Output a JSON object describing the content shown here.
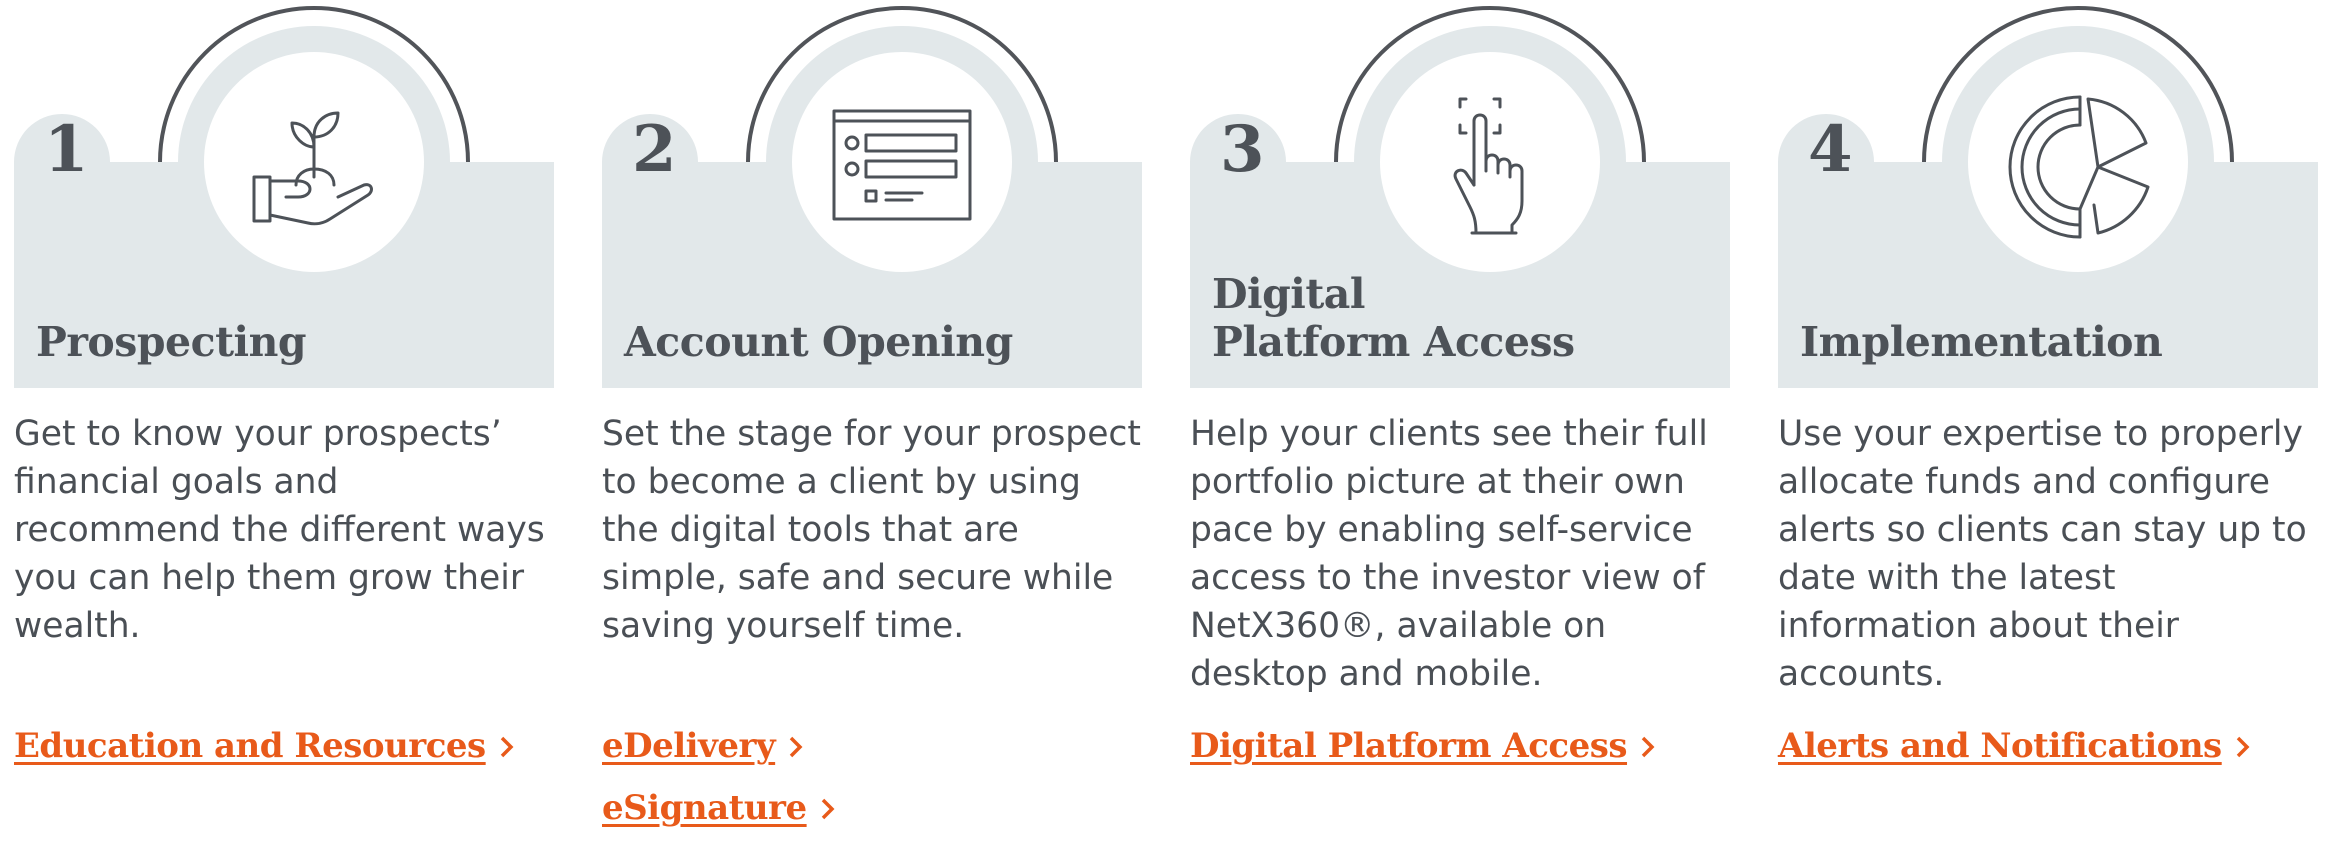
{
  "colors": {
    "card_bg": "#e2e8ea",
    "arc": "#515459",
    "text": "#4a4f55",
    "link": "#e85a1a"
  },
  "steps": [
    {
      "number": "1",
      "title": "Prospecting",
      "icon": "plant-in-hand-icon",
      "description": "Get to know your prospects’ financial goals and recommend the different ways you can help them grow their wealth.",
      "links": [
        {
          "label": "Education and Resources"
        }
      ]
    },
    {
      "number": "2",
      "title": "Account Opening",
      "icon": "online-form-icon",
      "description": "Set the stage for your prospect to become a client by using the digital tools that are simple, safe and secure while saving yourself time.",
      "links": [
        {
          "label": "eDelivery"
        },
        {
          "label": "eSignature"
        }
      ]
    },
    {
      "number": "3",
      "title": "Digital\nPlatform Access",
      "icon": "touch-hand-icon",
      "description": "Help your clients see their full portfolio picture at their own pace by enabling self-service access to the investor view of NetX360®, available on desktop and mobile.",
      "links": [
        {
          "label": "Digital Platform Access"
        }
      ]
    },
    {
      "number": "4",
      "title": "Implementation",
      "icon": "allocation-chart-icon",
      "description": "Use your expertise to properly allocate funds and configure alerts so clients can stay up to date with the latest information about their accounts.",
      "links": [
        {
          "label": "Alerts and Notifications"
        }
      ]
    }
  ]
}
